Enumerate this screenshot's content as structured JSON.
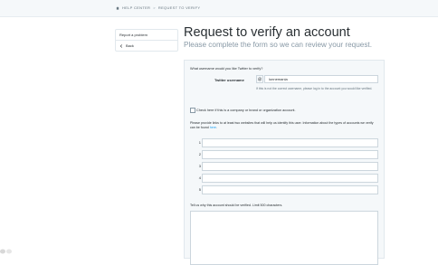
{
  "breadcrumb": {
    "home_icon": "home-icon",
    "items": [
      "HELP CENTER",
      "REQUEST TO VERIFY"
    ],
    "separator": ">"
  },
  "sidebar": {
    "items": [
      {
        "label": "Report a problem"
      },
      {
        "label": "Back",
        "icon": "arrow-left-icon"
      }
    ]
  },
  "header": {
    "title": "Request to verify an account",
    "subtitle": "Please complete the form so we can review your request."
  },
  "form": {
    "username_question": "What username would you like Twitter to verify?",
    "username_label": "Twitter username",
    "at_symbol": "@",
    "username_value": "lunnemania",
    "username_hint": "If this is not the correct username, please log in to the account you would like verified.",
    "company_checkbox_label": "Check here if this is a company or brand or organization account.",
    "company_checked": false,
    "websites_prompt": "Please provide links to at least two websites that will help us identify this user. Information about the types of accounts we verify can be found",
    "websites_link": "here",
    "websites_period": ".",
    "website_numbers": [
      "1",
      "2",
      "3",
      "4",
      "5"
    ],
    "reason_label": "Tell us why this account should be verified. Limit 500 characters."
  },
  "colors": {
    "accent": "#1da1f2",
    "form_background": "#f5f8fa",
    "subtitle": "#8899a6"
  }
}
